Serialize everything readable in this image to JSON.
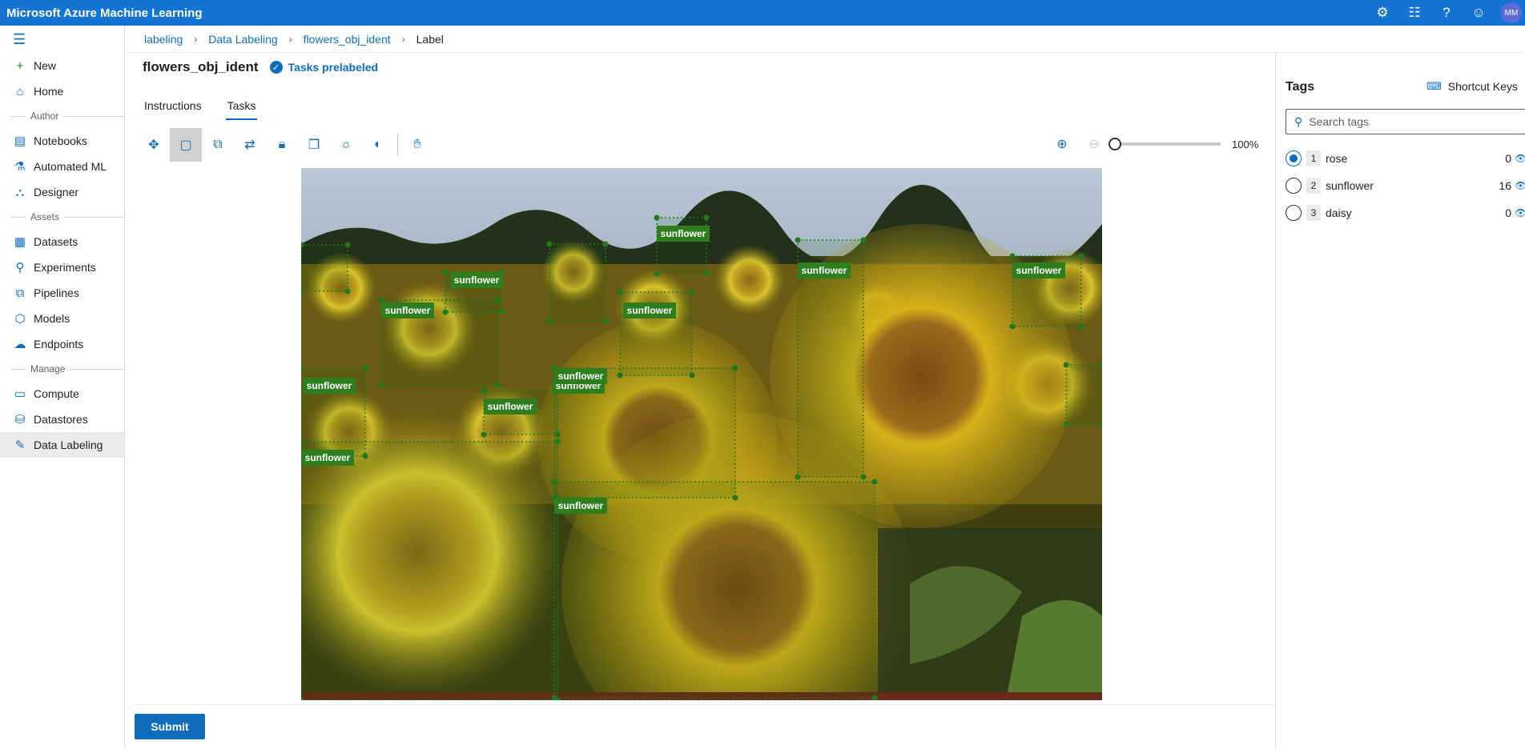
{
  "app": {
    "title": "Microsoft Azure Machine Learning",
    "avatar": "MM"
  },
  "topbar_icons": [
    "gear-icon",
    "notes-icon",
    "help-icon",
    "feedback-icon"
  ],
  "sidebar": {
    "items": [
      {
        "label": "New",
        "icon": "plus-icon"
      },
      {
        "label": "Home",
        "icon": "home-icon"
      },
      {
        "section": "Author"
      },
      {
        "label": "Notebooks",
        "icon": "notebook-icon"
      },
      {
        "label": "Automated ML",
        "icon": "automl-icon"
      },
      {
        "label": "Designer",
        "icon": "designer-icon"
      },
      {
        "section": "Assets"
      },
      {
        "label": "Datasets",
        "icon": "dataset-icon"
      },
      {
        "label": "Experiments",
        "icon": "flask-icon"
      },
      {
        "label": "Pipelines",
        "icon": "pipeline-icon"
      },
      {
        "label": "Models",
        "icon": "cube-icon"
      },
      {
        "label": "Endpoints",
        "icon": "cloud-icon"
      },
      {
        "section": "Manage"
      },
      {
        "label": "Compute",
        "icon": "monitor-icon"
      },
      {
        "label": "Datastores",
        "icon": "database-icon"
      },
      {
        "label": "Data Labeling",
        "icon": "label-icon",
        "active": true
      }
    ]
  },
  "breadcrumb": [
    "labeling",
    "Data Labeling",
    "flowers_obj_ident",
    "Label"
  ],
  "page": {
    "title": "flowers_obj_ident",
    "status": "Tasks prelabeled"
  },
  "tabs": [
    {
      "label": "Instructions"
    },
    {
      "label": "Tasks",
      "active": true
    }
  ],
  "toolbar": {
    "tools": [
      "move-icon",
      "rectangle-icon",
      "copy-icon",
      "swap-icon",
      "lock-icon",
      "layers-icon",
      "brightness-icon",
      "contrast-icon",
      "pan-hand-icon"
    ],
    "zoom_percent": "100%",
    "zoom_level": 0.0
  },
  "image": {
    "boxes": [
      {
        "label": "sunflower"
      },
      {
        "label": "sunflower"
      },
      {
        "label": "sunflower"
      },
      {
        "label": "sunflower"
      },
      {
        "label": "sunflower"
      },
      {
        "label": "sunflower"
      },
      {
        "label": "sunflower"
      },
      {
        "label": "sunflower"
      },
      {
        "label": "sunflower"
      },
      {
        "label": "sunflower"
      },
      {
        "label": "sunflower"
      },
      {
        "label": "sunflower"
      }
    ]
  },
  "submit_label": "Submit",
  "tags_panel": {
    "title": "Tags",
    "shortcut_label": "Shortcut Keys",
    "search_placeholder": "Search tags",
    "tags": [
      {
        "num": "1",
        "name": "rose",
        "count": "0",
        "selected": true
      },
      {
        "num": "2",
        "name": "sunflower",
        "count": "16"
      },
      {
        "num": "3",
        "name": "daisy",
        "count": "0"
      }
    ]
  },
  "colors": {
    "accent": "#0f6cbd",
    "topbar": "#1474d4",
    "box_label": "#2e7d1f"
  }
}
